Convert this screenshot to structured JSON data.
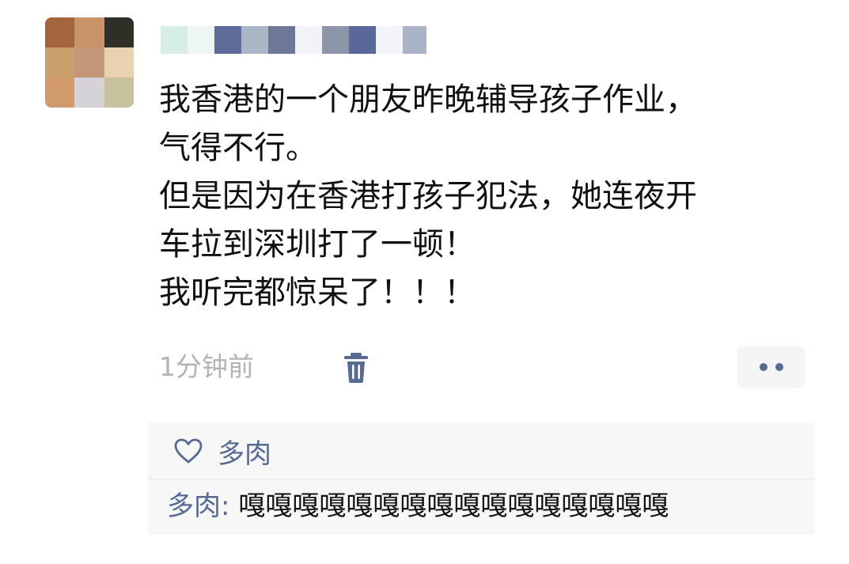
{
  "post": {
    "lines": [
      "我香港的一个朋友昨晚辅导孩子作业，",
      "气得不行。",
      "但是因为在香港打孩子犯法，她连夜开",
      "车拉到深圳打了一顿！",
      "我听完都惊呆了！！！"
    ],
    "timestamp": "1分钟前"
  },
  "likes": {
    "names": "多肉"
  },
  "comments": [
    {
      "author": "多肉",
      "separator": ": ",
      "text": "嘎嘎嘎嘎嘎嘎嘎嘎嘎嘎嘎嘎嘎嘎嘎嘎"
    }
  ],
  "icons": {
    "delete": "trash-icon",
    "more": "more-dots-icon",
    "like": "heart-outline-icon"
  },
  "colors": {
    "link": "#586a92",
    "text": "#111111",
    "timestamp": "#b3b3b3",
    "comment_background": "#f7f7f7"
  }
}
